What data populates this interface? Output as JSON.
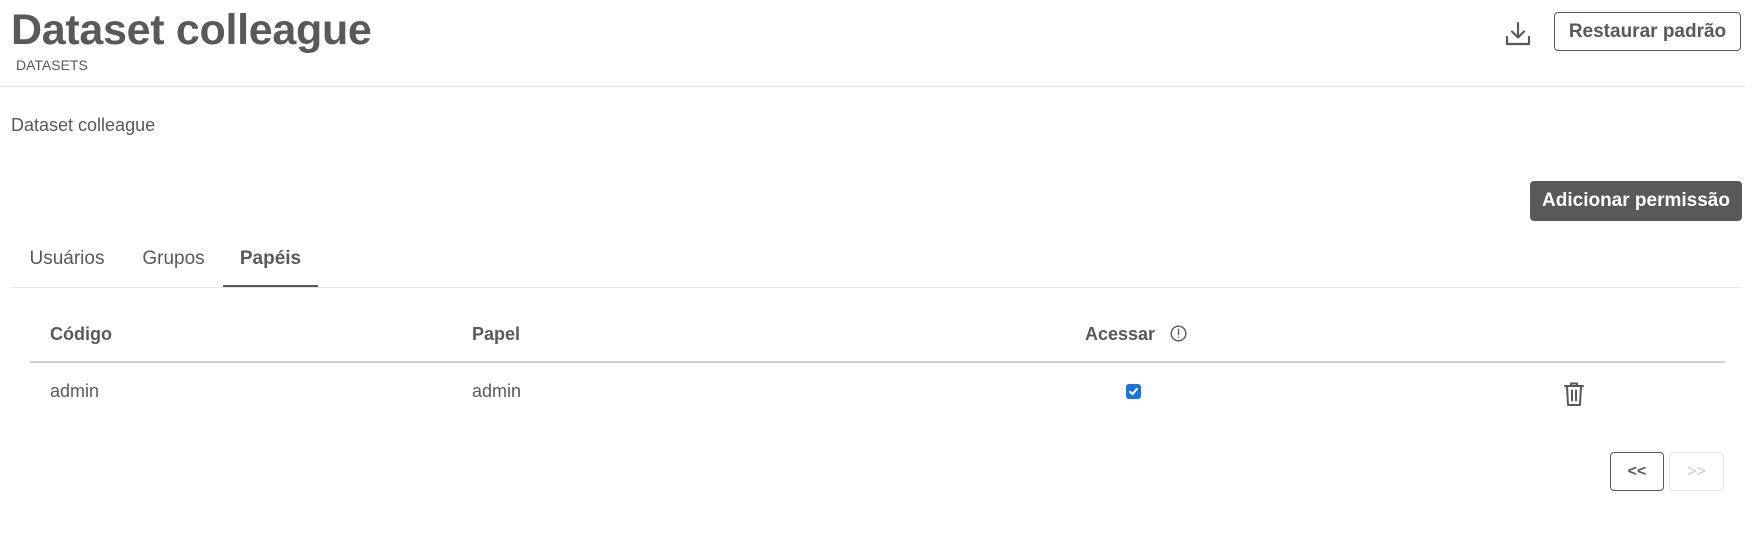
{
  "header": {
    "title": "Dataset colleague",
    "subtitle": "DATASETS",
    "restore_label": "Restaurar padrão",
    "download_icon": "download-icon"
  },
  "description": "Dataset colleague",
  "add_permission_label": "Adicionar permissão",
  "tabs": [
    {
      "label": "Usuários",
      "active": false
    },
    {
      "label": "Grupos",
      "active": false
    },
    {
      "label": "Papéis",
      "active": true
    }
  ],
  "table": {
    "columns": {
      "code": "Código",
      "role": "Papel",
      "access": "Acessar"
    },
    "rows": [
      {
        "code": "admin",
        "role": "admin",
        "access": true
      }
    ]
  },
  "pagination": {
    "prev_label": "<<",
    "next_label": ">>",
    "next_disabled": true
  },
  "colors": {
    "text": "#58595b",
    "accent": "#1a73d9",
    "primary_button": "#58595b"
  }
}
